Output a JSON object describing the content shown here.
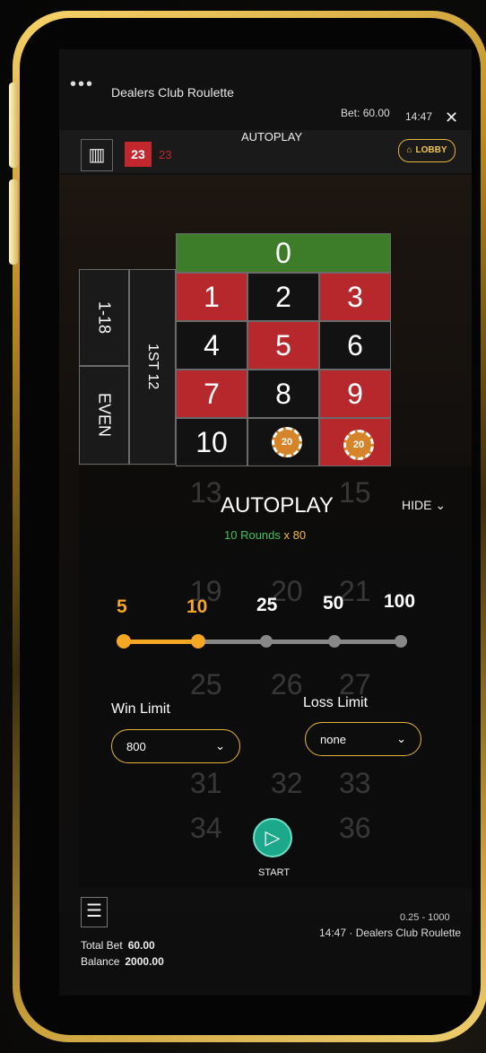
{
  "header": {
    "menu_dots": "•••",
    "app_title": "Dealers Club Roulette",
    "bet_label": "Bet:",
    "bet_value": "60.00",
    "clock": "14:47",
    "close": "✕",
    "mode_title": "AUTOPLAY",
    "lobby_label": "LOBBY"
  },
  "history": {
    "last_number": "23",
    "previous_number": "23"
  },
  "board": {
    "zero": "0",
    "numbers": [
      "1",
      "2",
      "3",
      "4",
      "5",
      "6",
      "7",
      "8",
      "9",
      "10"
    ],
    "side_bets": {
      "low": "1-18",
      "even": "EVEN",
      "dozen": "1ST 12"
    },
    "chips": [
      "20",
      "20"
    ]
  },
  "autoplay": {
    "title": "AUTOPLAY",
    "hide_label": "HIDE",
    "rounds_text": "10 Rounds",
    "multiplier_text": "x 80",
    "levels": [
      "5",
      "10",
      "25",
      "50",
      "100"
    ],
    "selected_level": "10",
    "win_limit_label": "Win Limit",
    "win_limit_value": "800",
    "loss_limit_label": "Loss Limit",
    "loss_limit_value": "none",
    "start_label": "START"
  },
  "footer": {
    "total_bet_label": "Total Bet",
    "total_bet_value": "60.00",
    "balance_label": "Balance",
    "balance_value": "2000.00",
    "table_limits": "0.25 - 1000",
    "footer_clock": "14:47",
    "footer_table": "Dealers Club Roulette"
  },
  "colors": {
    "accent": "#f5a623",
    "red": "#b7282d",
    "green": "#3d7d2a",
    "teal": "#1ca88a",
    "gold": "#e4b63c"
  }
}
